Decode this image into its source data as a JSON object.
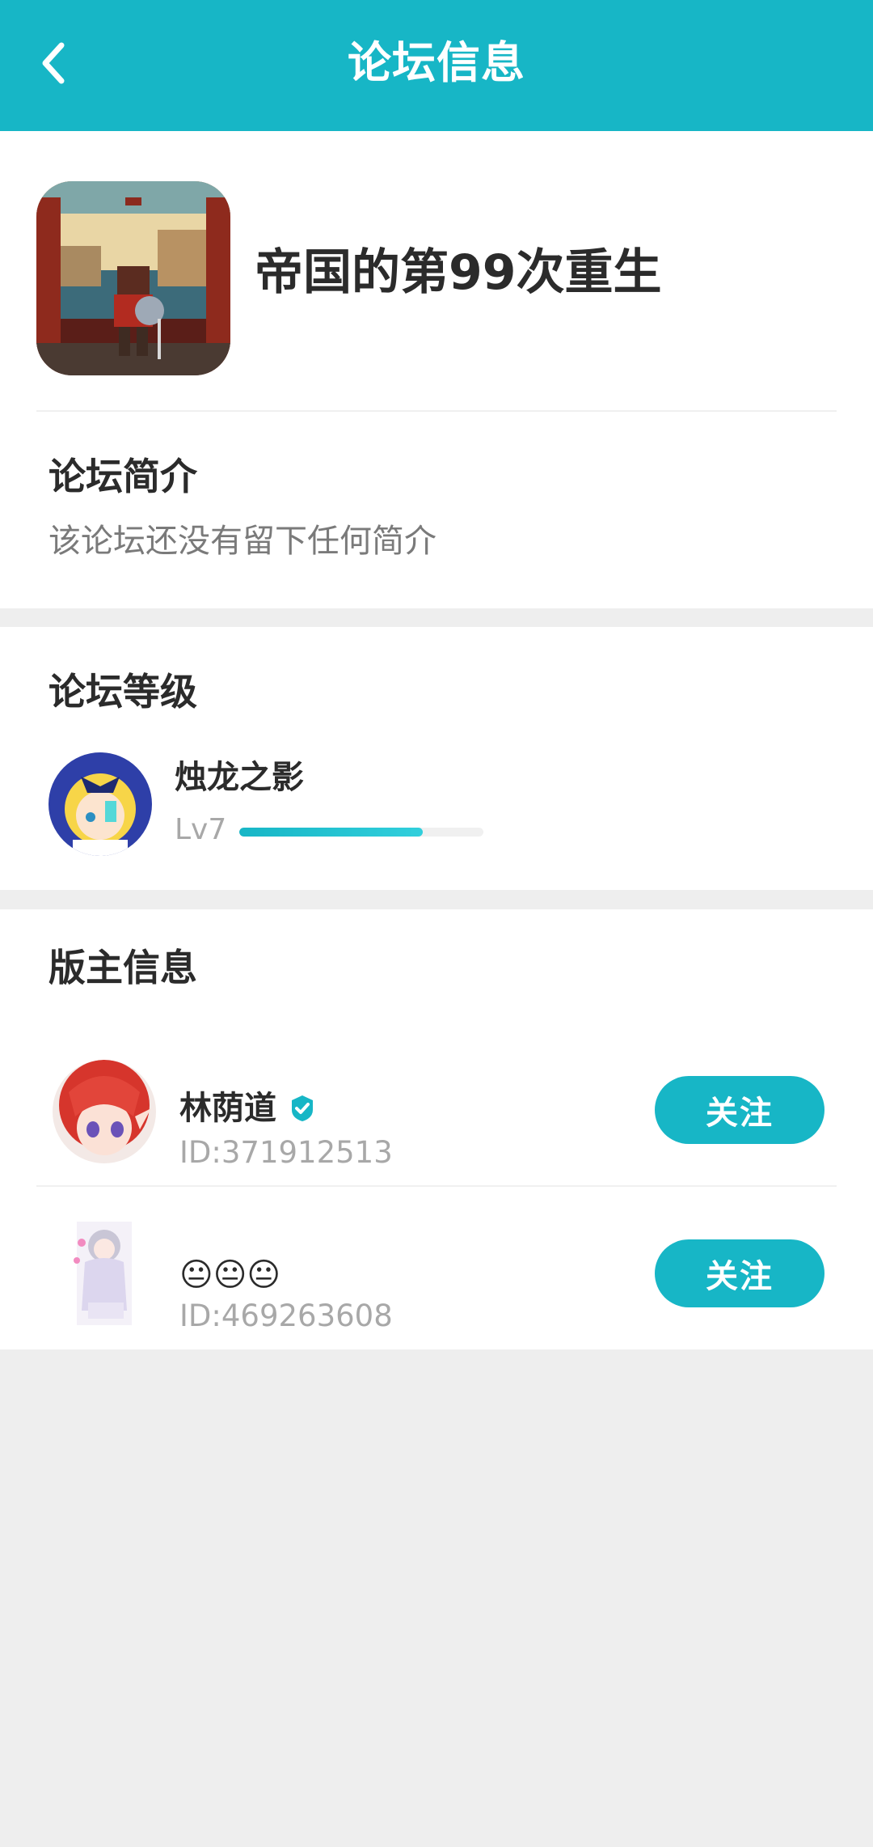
{
  "header": {
    "title": "论坛信息",
    "back_icon": "chevron-left-icon",
    "background": "#17B6C6"
  },
  "forum": {
    "name": "帝国的第99次重生",
    "icon": "pixel-art-warrior-game-icon"
  },
  "intro": {
    "title": "论坛简介",
    "text": "该论坛还没有留下任何简介"
  },
  "level": {
    "title": "论坛等级",
    "name": "烛龙之影",
    "label": "Lv7",
    "progress": 0.75
  },
  "moderators": {
    "title": "版主信息",
    "items": [
      {
        "name": "林荫道",
        "verified": true,
        "id_text": "ID:371912513",
        "follow_label": "关注",
        "avatar": "red-haired-anime-avatar"
      },
      {
        "name": "😐😐😐",
        "verified": false,
        "id_text": "ID:469263608",
        "follow_label": "关注",
        "avatar": "anime-girl-avatar"
      }
    ]
  },
  "colors": {
    "accent": "#17B6C6",
    "page_background": "#EEEEEE",
    "muted_text": "#A8A8A8"
  }
}
